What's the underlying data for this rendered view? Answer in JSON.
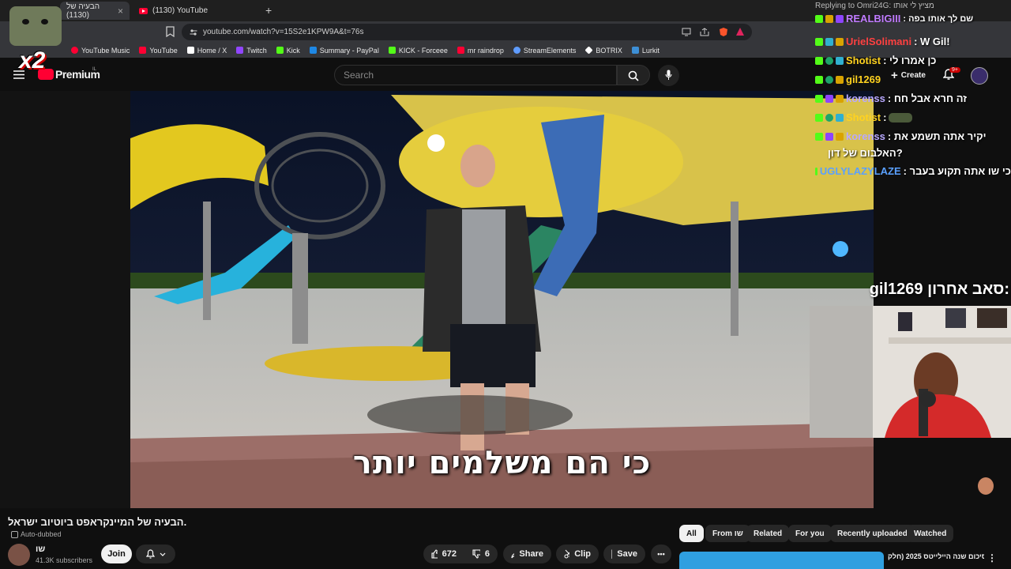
{
  "browser": {
    "tabs": [
      {
        "label": "הבעיה של (1130)",
        "active": true
      },
      {
        "label": "(1130) YouTube",
        "active": false
      }
    ],
    "new_tab": "+",
    "url": "youtube.com/watch?v=15S2e1KPW9A&t=76s",
    "bookmarks": [
      {
        "label": "YouTube Music",
        "color": "#ff0033"
      },
      {
        "label": "YouTube",
        "color": "#ff0033"
      },
      {
        "label": "Home / X",
        "color": "#ffffff"
      },
      {
        "label": "Twitch",
        "color": "#9146ff"
      },
      {
        "label": "Kick",
        "color": "#53fc18"
      },
      {
        "label": "Summary - PayPal",
        "color": "#1e88e5"
      },
      {
        "label": "KICK - Forceee",
        "color": "#53fc18"
      },
      {
        "label": "mr raindrop",
        "color": "#ff0033"
      },
      {
        "label": "StreamElements",
        "color": "#5f9cff"
      },
      {
        "label": "BOTRIX",
        "color": "#ffffff"
      },
      {
        "label": "Lurkit",
        "color": "#3d8fd6"
      }
    ]
  },
  "youtube": {
    "logo_text": "Premium",
    "logo_sup": "IL",
    "search_placeholder": "Search",
    "create_label": "Create",
    "notif_count": "9+"
  },
  "overlay": {
    "multiplier": "x2"
  },
  "video": {
    "subtitle": "כי הם משלמים יותר",
    "title": "הבעיה של המיינקראפט ביוטיוב ישראל.",
    "auto_dubbed": "Auto-dubbed",
    "channel_name": "שו",
    "subscribers": "41.3K subscribers",
    "join": "Join",
    "likes": "672",
    "dislikes": "6",
    "share": "Share",
    "clip": "Clip",
    "save": "Save",
    "more": "•••"
  },
  "chips": [
    "All",
    "From שו",
    "Related",
    "For you",
    "Recently uploaded",
    "Watched"
  ],
  "next_video_title": "סיכום שנה היילייטס 2025 (חלק",
  "chat": {
    "reply_banner": "Replying to Omri24G: מציץ לי אותו",
    "pinned_user": "REALBIGIII",
    "pinned_msg": ": שם לך אותו בפה",
    "lines": [
      {
        "user": "UrielSolimani",
        "color": "#ff4040",
        "msg": ": W Gil!"
      },
      {
        "user": "Shotist",
        "color": "#ffd21f",
        "msg": ": כן אמרו לי"
      },
      {
        "user": "gil1269",
        "color": "#ffd21f",
        "msg": ""
      },
      {
        "user": "korenss",
        "color": "#b8a8ff",
        "msg": ": זה חרא אבל חח"
      },
      {
        "user": "Shotist",
        "color": "#ffd21f",
        "msg": ":"
      },
      {
        "user": "korenss",
        "color": "#b8a8ff",
        "msg": ": יקיר אתה תשמע את"
      },
      {
        "user": "",
        "color": "#ffffff",
        "msg": "האלבום של דון?"
      },
      {
        "user": "UGLYLAZYLAZE",
        "color": "#5aa0ff",
        "msg": ": כי שו אתה תקוע בעבר"
      }
    ],
    "last_sub_label": "סאב אחרון:",
    "last_sub_user": "gil1269"
  }
}
